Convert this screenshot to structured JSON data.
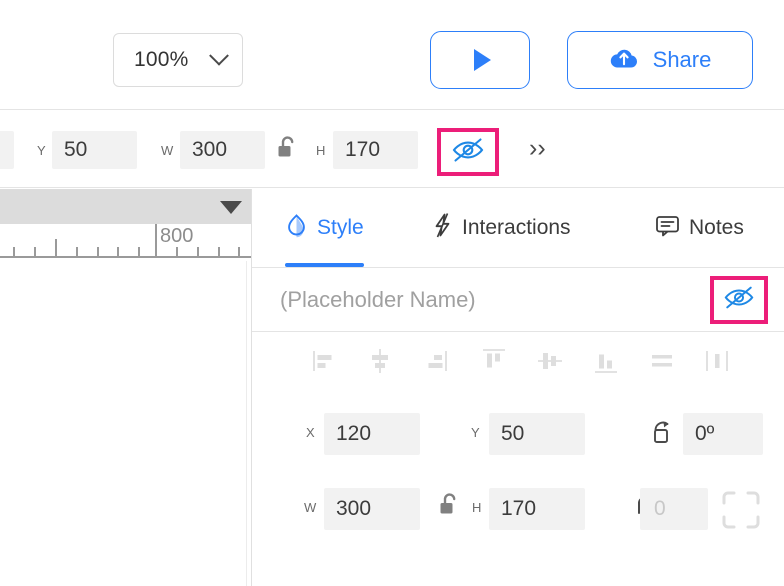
{
  "topbar": {
    "zoom": {
      "value": "100%",
      "icon": "chevron-down-icon"
    },
    "play": {
      "icon": "play-icon",
      "label": ""
    },
    "share": {
      "label": "Share",
      "icon": "cloud-upload-icon"
    },
    "accent_blue": "#2d7ff9"
  },
  "property_strip": {
    "fields": [
      {
        "label": "Y",
        "value": "50"
      },
      {
        "label": "W",
        "value": "300"
      },
      {
        "label": "H",
        "value": "170"
      }
    ],
    "lock_icon": "unlock-icon",
    "visibility_icon": "eye-off-icon",
    "overflow_label": "››",
    "highlight_color": "#ec1e79"
  },
  "canvas": {
    "ruler": {
      "label": "800"
    },
    "dropdown_icon": "triangle-down-icon"
  },
  "panel": {
    "tabs": [
      {
        "label": "Style",
        "icon": "droplet-icon",
        "active": true
      },
      {
        "label": "Interactions",
        "icon": "lightning-bolt-icon",
        "active": false
      },
      {
        "label": "Notes",
        "icon": "comment-icon",
        "active": false
      }
    ],
    "name_field": {
      "value": "(Placeholder Name)",
      "placeholder": "(Placeholder Name)"
    },
    "visibility_icon": "eye-off-icon",
    "align_icons": [
      "align-left-icon",
      "align-center-horizontal-icon",
      "align-right-icon",
      "align-top-icon",
      "align-center-vertical-icon",
      "align-bottom-icon",
      "distribute-horizontal-icon",
      "distribute-vertical-icon"
    ],
    "position": [
      {
        "label": "X",
        "value": "120"
      },
      {
        "label": "Y",
        "value": "50"
      },
      {
        "label": "",
        "value": "0º",
        "icon": "rotate-icon"
      }
    ],
    "size": [
      {
        "label": "W",
        "value": "300"
      },
      {
        "label": "H",
        "value": "170"
      },
      {
        "label": "",
        "value": "0",
        "icon": "corner-radius-icon",
        "disabled": true
      }
    ],
    "lock_icon": "unlock-icon",
    "constrain_icon": "crop-frame-icon"
  }
}
